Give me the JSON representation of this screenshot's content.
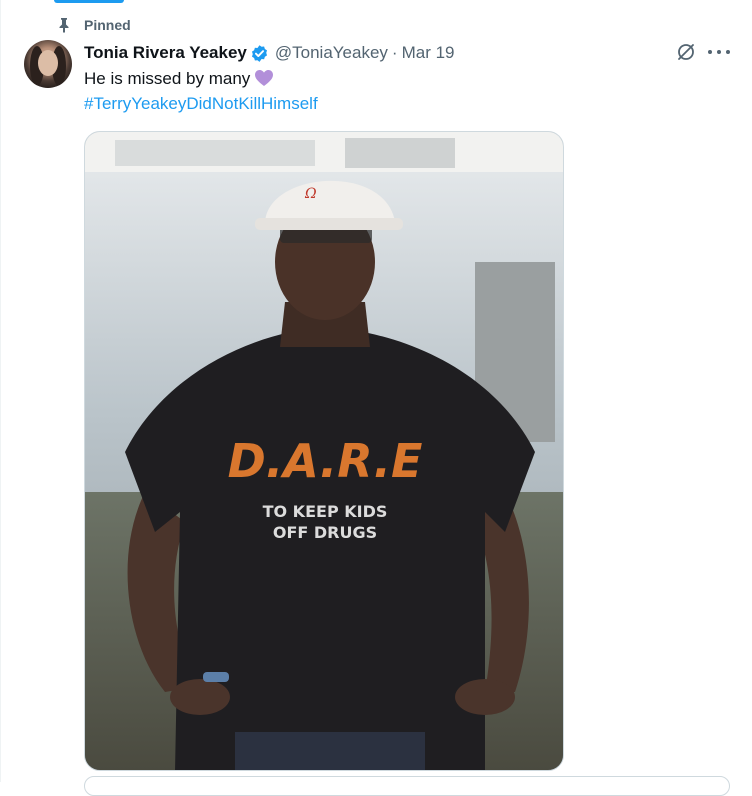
{
  "pinned": {
    "label": "Pinned",
    "icon": "pin-icon"
  },
  "author": {
    "display_name": "Tonia Rivera Yeakey",
    "handle": "@ToniaYeakey",
    "separator": "·",
    "date": "Mar 19",
    "verified": true
  },
  "tweet": {
    "text": "He is missed by many",
    "emoji": "purple-heart",
    "hashtag": "#TerryYeakeyDidNotKillHimself"
  },
  "photo": {
    "shirt_main": "D.A.R.E",
    "shirt_line1": "TO KEEP KIDS",
    "shirt_line2": "OFF DRUGS"
  },
  "colors": {
    "accent": "#1d9bf0",
    "text": "#0f1419",
    "muted": "#536471",
    "heart": "#b28fd9",
    "shirt_print": "#d9772e"
  },
  "icons": [
    "pin-icon",
    "verified-badge-icon",
    "grok-icon",
    "more-options-icon",
    "purple-heart-emoji"
  ]
}
